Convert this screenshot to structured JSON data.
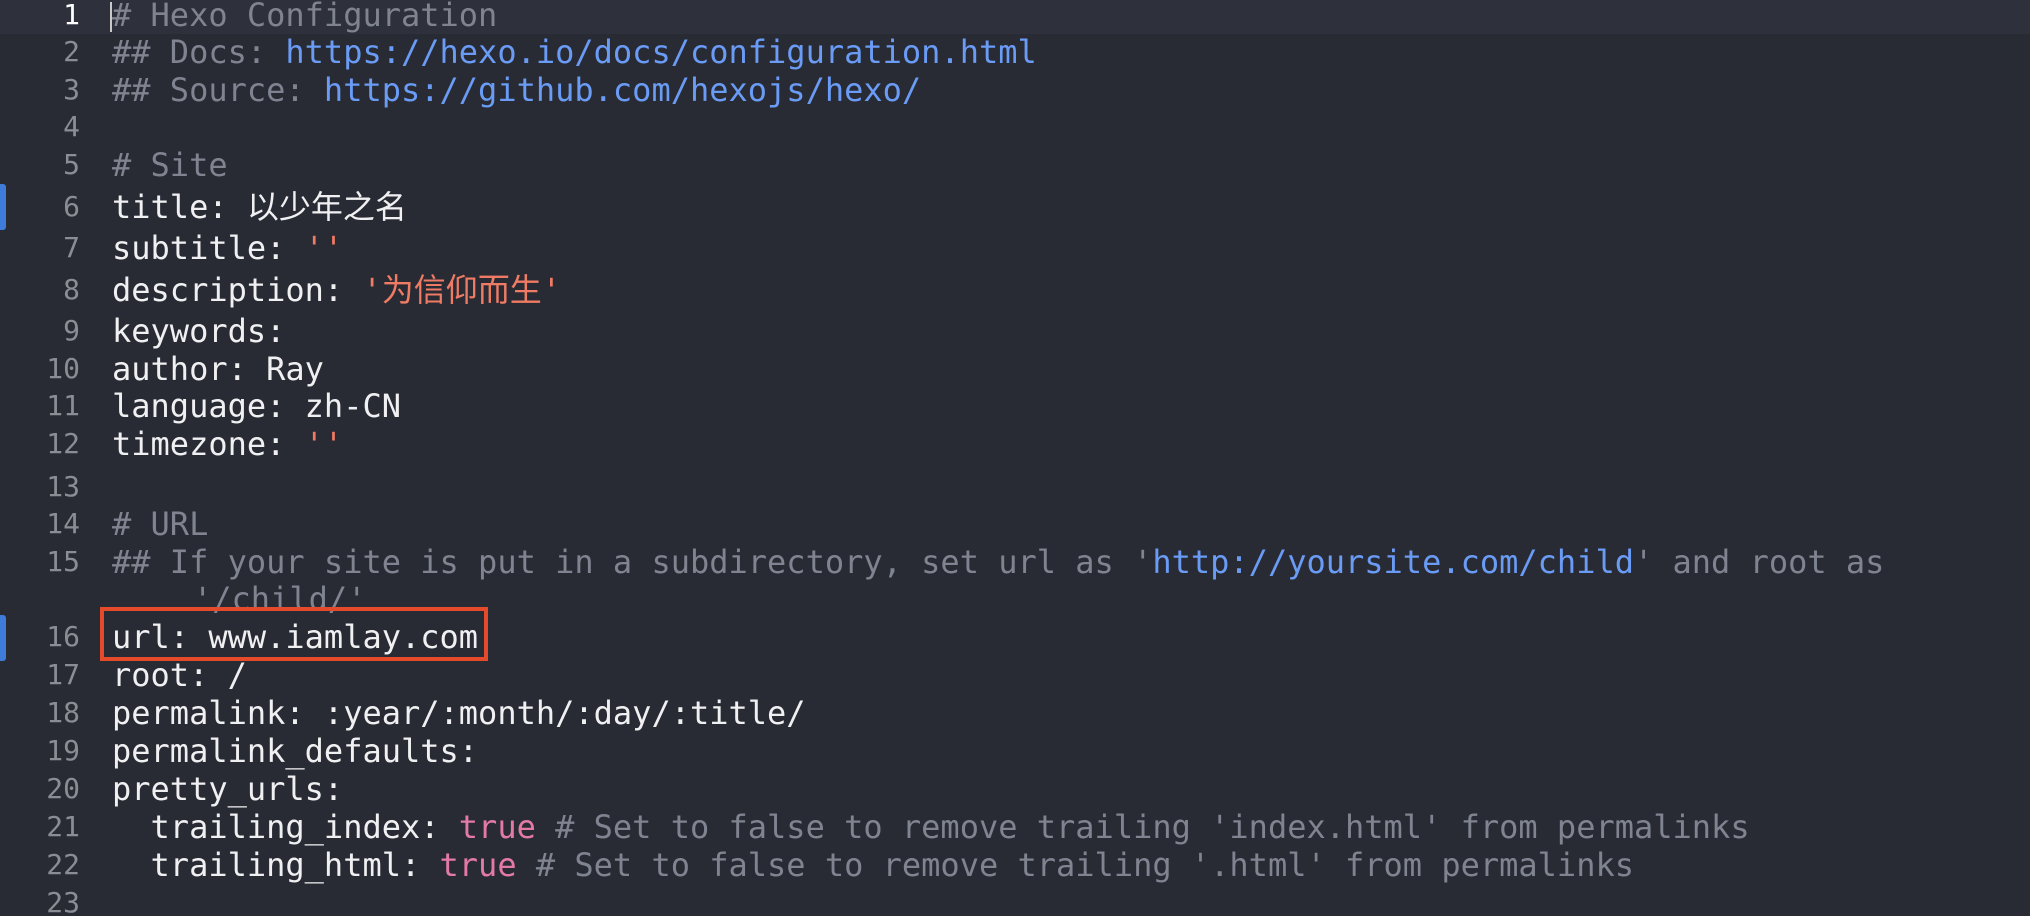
{
  "editor": {
    "lines": [
      {
        "num": "1",
        "segments": [
          {
            "t": "# Hexo Configuration",
            "c": "comment"
          }
        ]
      },
      {
        "num": "2",
        "segments": [
          {
            "t": "## Docs: ",
            "c": "comment"
          },
          {
            "t": "https://hexo.io/docs/configuration.html",
            "c": "link"
          }
        ]
      },
      {
        "num": "3",
        "segments": [
          {
            "t": "## Source: ",
            "c": "comment"
          },
          {
            "t": "https://github.com/hexojs/hexo/",
            "c": "link"
          }
        ]
      },
      {
        "num": "4",
        "segments": []
      },
      {
        "num": "5",
        "segments": [
          {
            "t": "# Site",
            "c": "comment"
          }
        ]
      },
      {
        "num": "6",
        "segments": [
          {
            "t": "title: ",
            "c": "key"
          },
          {
            "t": "以少年之名",
            "c": "plain"
          }
        ]
      },
      {
        "num": "7",
        "segments": [
          {
            "t": "subtitle: ",
            "c": "key"
          },
          {
            "t": "''",
            "c": "string"
          }
        ]
      },
      {
        "num": "8",
        "segments": [
          {
            "t": "description: ",
            "c": "key"
          },
          {
            "t": "'为信仰而生'",
            "c": "string"
          }
        ]
      },
      {
        "num": "9",
        "segments": [
          {
            "t": "keywords:",
            "c": "key"
          }
        ]
      },
      {
        "num": "10",
        "segments": [
          {
            "t": "author: ",
            "c": "key"
          },
          {
            "t": "Ray",
            "c": "plain"
          }
        ]
      },
      {
        "num": "11",
        "segments": [
          {
            "t": "language: ",
            "c": "key"
          },
          {
            "t": "zh-CN",
            "c": "plain"
          }
        ]
      },
      {
        "num": "12",
        "segments": [
          {
            "t": "timezone: ",
            "c": "key"
          },
          {
            "t": "''",
            "c": "string"
          }
        ]
      },
      {
        "num": "13",
        "segments": []
      },
      {
        "num": "14",
        "segments": [
          {
            "t": "# URL",
            "c": "comment"
          }
        ]
      },
      {
        "num": "15",
        "segments": [
          {
            "t": "## If your site is put in a subdirectory, set url as '",
            "c": "comment"
          },
          {
            "t": "http://yoursite.com/child",
            "c": "link"
          },
          {
            "t": "' and root as",
            "c": "comment"
          }
        ],
        "wrap": [
          {
            "t": "'/child/'",
            "c": "comment"
          }
        ]
      },
      {
        "num": "16",
        "segments": [
          {
            "t": "url: ",
            "c": "key"
          },
          {
            "t": "www.iamlay.com",
            "c": "plain"
          }
        ]
      },
      {
        "num": "17",
        "segments": [
          {
            "t": "root: ",
            "c": "key"
          },
          {
            "t": "/",
            "c": "plain"
          }
        ]
      },
      {
        "num": "18",
        "segments": [
          {
            "t": "permalink: ",
            "c": "key"
          },
          {
            "t": ":year/:month/:day/:title/",
            "c": "plain"
          }
        ]
      },
      {
        "num": "19",
        "segments": [
          {
            "t": "permalink_defaults:",
            "c": "key"
          }
        ]
      },
      {
        "num": "20",
        "segments": [
          {
            "t": "pretty_urls:",
            "c": "key"
          }
        ]
      },
      {
        "num": "21",
        "segments": [
          {
            "t": "  trailing_index: ",
            "c": "key"
          },
          {
            "t": "true",
            "c": "bool"
          },
          {
            "t": " # Set to false to remove trailing 'index.html' from permalinks",
            "c": "comment"
          }
        ]
      },
      {
        "num": "22",
        "segments": [
          {
            "t": "  trailing_html: ",
            "c": "key"
          },
          {
            "t": "true",
            "c": "bool"
          },
          {
            "t": " # Set to false to remove trailing '.html' from permalinks",
            "c": "comment"
          }
        ]
      },
      {
        "num": "23",
        "segments": []
      }
    ],
    "colors": {
      "background": "#282b34",
      "comment": "#7f8490",
      "link": "#6a9bf5",
      "string": "#ef7b65",
      "bool": "#e37aa6",
      "text": "#f0f0f2",
      "highlight_border": "#e54b2a",
      "change_marker": "#3f7cd9"
    }
  }
}
